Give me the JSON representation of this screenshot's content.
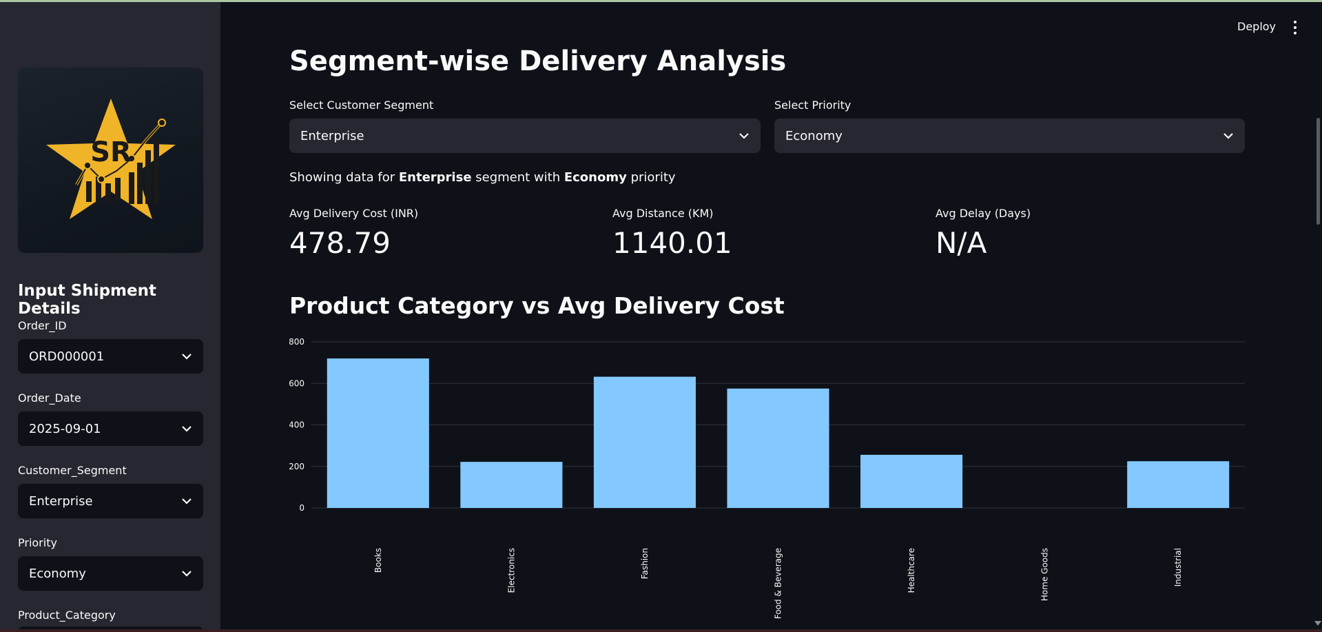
{
  "app": {
    "deploy_label": "Deploy"
  },
  "sidebar": {
    "logo_text": "SR",
    "section_title": "Input Shipment Details",
    "fields": [
      {
        "label": "Order_ID",
        "value": "ORD000001"
      },
      {
        "label": "Order_Date",
        "value": "2025-09-01"
      },
      {
        "label": "Customer_Segment",
        "value": "Enterprise"
      },
      {
        "label": "Priority",
        "value": "Economy"
      },
      {
        "label": "Product_Category",
        "value": ""
      }
    ]
  },
  "main": {
    "title": "Segment-wise Delivery Analysis",
    "segment_select": {
      "label": "Select Customer Segment",
      "value": "Enterprise"
    },
    "priority_select": {
      "label": "Select Priority",
      "value": "Economy"
    },
    "showing": {
      "prefix": "Showing data for ",
      "segment": "Enterprise",
      "middle": " segment with ",
      "priority": "Economy",
      "suffix": " priority"
    },
    "metrics": [
      {
        "label": "Avg Delivery Cost (INR)",
        "value": "478.79"
      },
      {
        "label": "Avg Distance (KM)",
        "value": "1140.01"
      },
      {
        "label": "Avg Delay (Days)",
        "value": "N/A"
      }
    ],
    "chart_title": "Product Category vs Avg Delivery Cost"
  },
  "colors": {
    "bar": "#83c9ff",
    "accent_logo": "#f0b429"
  },
  "chart_data": {
    "type": "bar",
    "title": "Product Category vs Avg Delivery Cost",
    "xlabel": "",
    "ylabel": "",
    "categories": [
      "Books",
      "Electronics",
      "Fashion",
      "Food & Beverage",
      "Healthcare",
      "Home Goods",
      "Industrial"
    ],
    "values": [
      720,
      222,
      632,
      575,
      256,
      0,
      225
    ],
    "ylim": [
      0,
      800
    ],
    "yticks": [
      0,
      200,
      400,
      600,
      800
    ],
    "grid": true
  }
}
